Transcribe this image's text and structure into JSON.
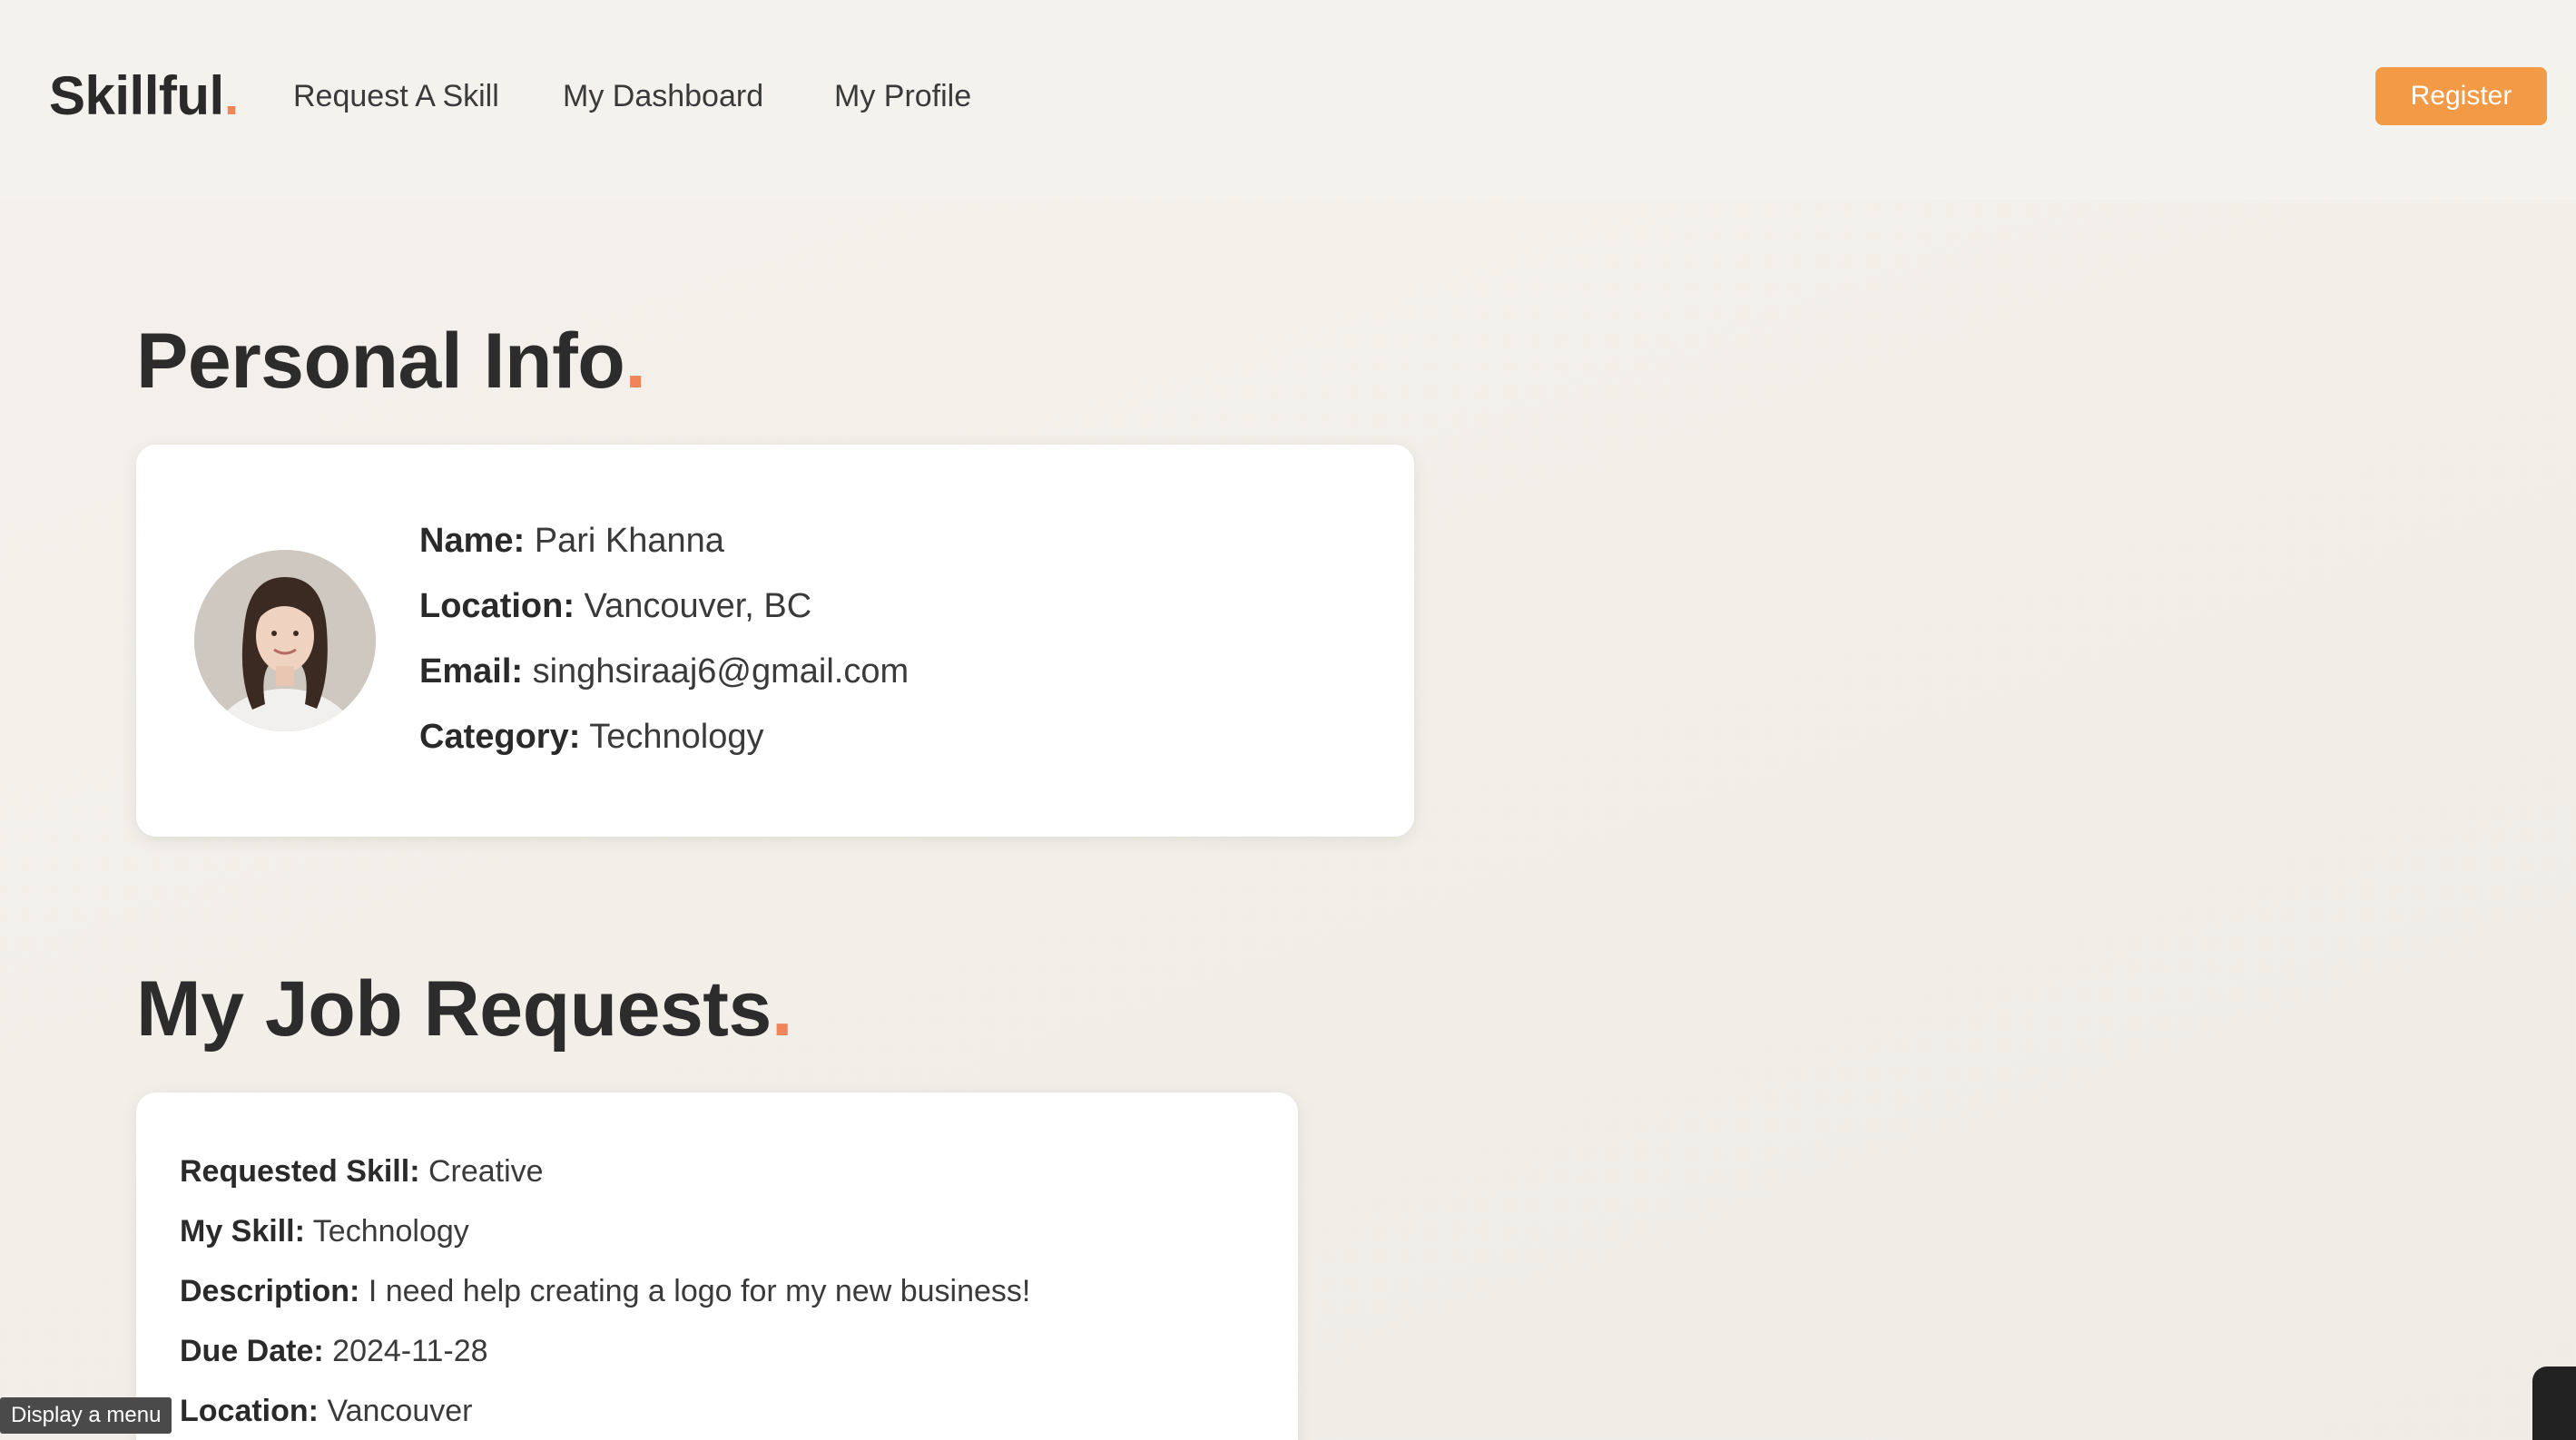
{
  "brand": {
    "name": "Skillful",
    "dot": "."
  },
  "nav": {
    "items": [
      {
        "label": "Request A Skill"
      },
      {
        "label": "My Dashboard"
      },
      {
        "label": "My Profile"
      }
    ],
    "register_label": "Register"
  },
  "personal_info": {
    "title": "Personal Info",
    "dot": ".",
    "fields": [
      {
        "label": "Name:",
        "value": "Pari Khanna"
      },
      {
        "label": "Location:",
        "value": "Vancouver, BC"
      },
      {
        "label": "Email:",
        "value": "singhsiraaj6@gmail.com"
      },
      {
        "label": "Category:",
        "value": "Technology"
      }
    ]
  },
  "job_requests": {
    "title": "My Job Requests",
    "dot": ".",
    "items": [
      {
        "fields": [
          {
            "label": "Requested Skill:",
            "value": "Creative"
          },
          {
            "label": "My Skill:",
            "value": "Technology"
          },
          {
            "label": "Description:",
            "value": "I need help creating a logo for my new business!"
          },
          {
            "label": "Due Date:",
            "value": "2024-11-28"
          },
          {
            "label": "Location:",
            "value": "Vancouver"
          }
        ]
      }
    ]
  },
  "tooltip": {
    "text": "Display a menu"
  },
  "colors": {
    "accent": "#f0855a",
    "button": "#f29a45",
    "background": "#f3f0eb",
    "card": "#ffffff"
  }
}
